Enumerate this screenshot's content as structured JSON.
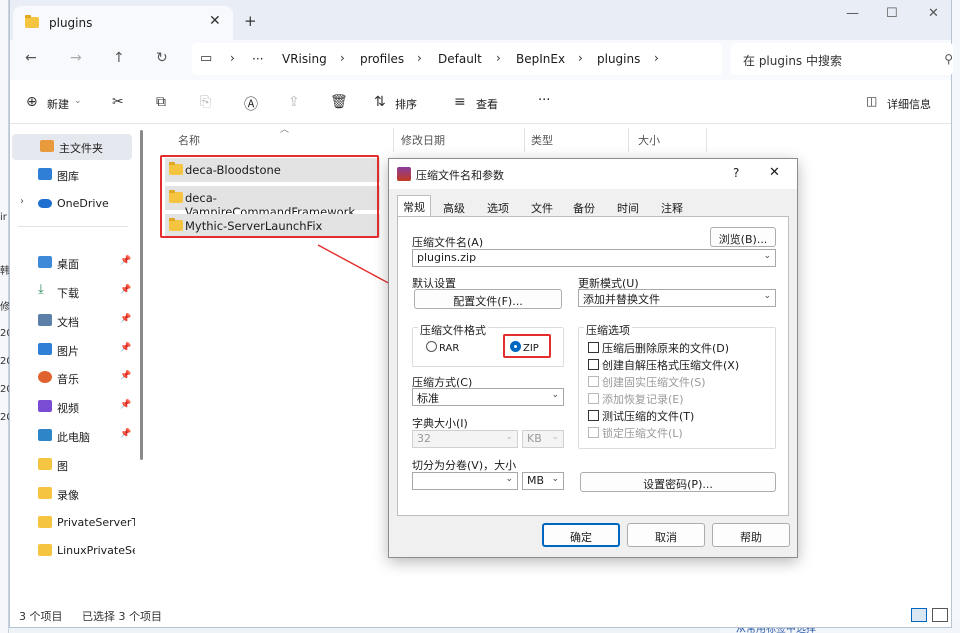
{
  "window": {
    "tab_title": "plugins",
    "tab_close": "✕",
    "new_tab": "+",
    "minimize": "—",
    "maximize": "☐",
    "close": "✕"
  },
  "nav": {
    "back": "←",
    "forward": "→",
    "up": "↑",
    "refresh": "↻",
    "breadcrumb": [
      "VRising",
      "profiles",
      "Default",
      "BepInEx",
      "plugins"
    ],
    "ellipsis": "···",
    "search_placeholder": "在 plugins 中搜索"
  },
  "toolbar": {
    "new_label": "新建",
    "sort_label": "排序",
    "view_label": "查看",
    "more": "···",
    "details_label": "详细信息"
  },
  "sidebar": {
    "items": [
      {
        "label": "主文件夹",
        "color": "#e89a3c"
      },
      {
        "label": "图库",
        "color": "#2f7fd6"
      },
      {
        "label": "OneDrive",
        "color": "#1f6fd1"
      },
      {
        "label": "桌面",
        "color": "#3f8ad8",
        "pinned": true
      },
      {
        "label": "下载",
        "color": "#2e8b57",
        "pinned": true
      },
      {
        "label": "文档",
        "color": "#5b7fa6",
        "pinned": true
      },
      {
        "label": "图片",
        "color": "#2f7fd6",
        "pinned": true
      },
      {
        "label": "音乐",
        "color": "#e0622f",
        "pinned": true
      },
      {
        "label": "视频",
        "color": "#7a4bd3",
        "pinned": true
      },
      {
        "label": "此电脑",
        "color": "#2e86c8",
        "pinned": true
      },
      {
        "label": "图",
        "color": "#f5c542"
      },
      {
        "label": "录像",
        "color": "#f5c542"
      },
      {
        "label": "PrivateServerT",
        "color": "#f5c542"
      },
      {
        "label": "LinuxPrivateSer",
        "color": "#f5c542"
      }
    ]
  },
  "files": {
    "columns": [
      "名称",
      "修改日期",
      "类型",
      "大小"
    ],
    "rows": [
      "deca-Bloodstone",
      "deca-VampireCommandFramework",
      "Mythic-ServerLaunchFix"
    ]
  },
  "status": {
    "count": "3 个项目",
    "selected": "已选择 3 个项目"
  },
  "dialog": {
    "title": "压缩文件名和参数",
    "help_q": "?",
    "close": "✕",
    "tabs": [
      "常规",
      "高级",
      "选项",
      "文件",
      "备份",
      "时间",
      "注释"
    ],
    "archive_name_label": "压缩文件名(A)",
    "browse_button": "浏览(B)...",
    "archive_name_value": "plugins.zip",
    "default_settings_label": "默认设置",
    "profiles_button": "配置文件(F)...",
    "update_mode_label": "更新模式(U)",
    "update_mode_value": "添加并替换文件",
    "format_group_label": "压缩文件格式",
    "format_rar": "RAR",
    "format_zip": "ZIP",
    "options_group_label": "压缩选项",
    "options": [
      {
        "label": "压缩后删除原来的文件(D)",
        "enabled": true
      },
      {
        "label": "创建自解压格式压缩文件(X)",
        "enabled": true
      },
      {
        "label": "创建固实压缩文件(S)",
        "enabled": false
      },
      {
        "label": "添加恢复记录(E)",
        "enabled": false
      },
      {
        "label": "测试压缩的文件(T)",
        "enabled": true
      },
      {
        "label": "锁定压缩文件(L)",
        "enabled": false
      }
    ],
    "method_label": "压缩方式(C)",
    "method_value": "标准",
    "dict_label": "字典大小(I)",
    "dict_value": "32",
    "dict_unit": "KB",
    "split_label": "切分为分卷(V)，大小",
    "split_value": "",
    "split_unit": "MB",
    "password_button": "设置密码(P)...",
    "ok_button": "确定",
    "cancel_button": "取消",
    "help_button": "帮助"
  },
  "background": {
    "left_fragments": [
      "ir",
      "韩",
      "修",
      "20",
      "20",
      "20",
      "20"
    ],
    "bottom_fragment": "从常用标签中选择"
  },
  "colors": {
    "highlight_red": "#e52d2d",
    "accent_blue": "#0067c0"
  }
}
